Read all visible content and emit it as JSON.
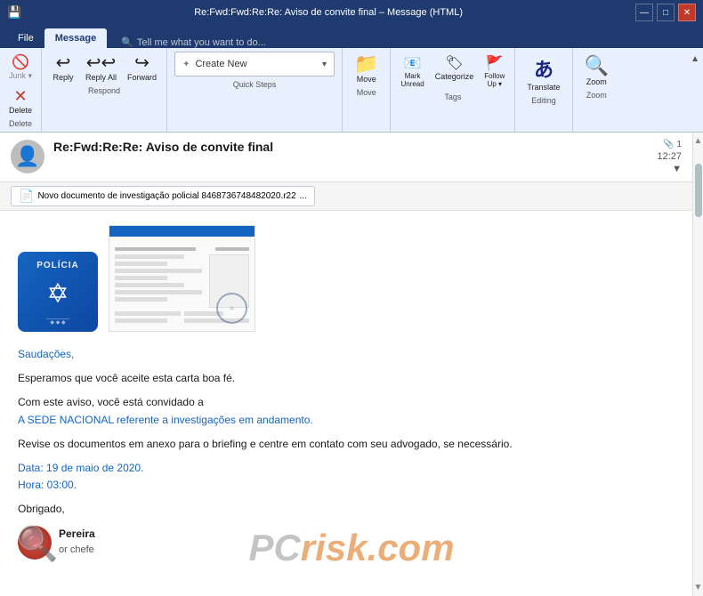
{
  "titlebar": {
    "title": "Re:Fwd:Fwd:Re:Re: Aviso de convite final – Message (HTML)",
    "save_icon": "💾",
    "controls": [
      "🗗",
      "—",
      "□",
      "✕"
    ]
  },
  "ribbon_tabs": {
    "tabs": [
      "File",
      "Message",
      "Tell me what you want to do..."
    ]
  },
  "ribbon": {
    "groups": [
      {
        "label": "Delete",
        "buttons": [
          {
            "id": "junk",
            "icon": "🚫",
            "label": "Junk"
          },
          {
            "id": "delete",
            "icon": "✕",
            "label": "Delete"
          }
        ]
      },
      {
        "label": "Respond",
        "buttons": [
          {
            "id": "reply",
            "icon": "↩",
            "label": "Reply"
          },
          {
            "id": "reply-all",
            "icon": "↩↩",
            "label": "Reply All"
          },
          {
            "id": "forward",
            "icon": "↪",
            "label": "Forward"
          }
        ]
      },
      {
        "label": "Quick Steps",
        "placeholder": "Create New"
      },
      {
        "label": "Move",
        "buttons": [
          {
            "id": "move",
            "icon": "📁",
            "label": "Move"
          }
        ]
      },
      {
        "label": "Tags",
        "buttons": [
          {
            "id": "mark-unread",
            "icon": "📧",
            "label": "Mark Unread"
          },
          {
            "id": "categorize",
            "icon": "🏷",
            "label": "Categorize"
          },
          {
            "id": "follow-up",
            "icon": "🚩",
            "label": "Follow Up"
          }
        ]
      },
      {
        "label": "Editing",
        "buttons": [
          {
            "id": "translate",
            "icon": "あ",
            "label": "Translate"
          }
        ]
      },
      {
        "label": "Zoom",
        "buttons": [
          {
            "id": "zoom",
            "icon": "🔍",
            "label": "Zoom"
          }
        ]
      }
    ]
  },
  "email": {
    "subject": "Re:Fwd:Re:Re: Aviso de convite final",
    "time": "12:27",
    "pin_count": "📎 1",
    "attachment": {
      "icon": "📄",
      "name": "Novo documento de investigação policial 8468736748482020.r22",
      "suffix": "..."
    },
    "body": {
      "greeting": "Saudações,",
      "para1": "Esperamos que você aceite esta carta boa fé.",
      "para2": "Com este aviso, você está convidado a",
      "para3": "A SEDE NACIONAL referente a investigações em andamento.",
      "para4": "Revise os documentos em anexo para o briefing e centre em contato com seu advogado, se necessário.",
      "date_label": "Data: 19 de maio de 2020.",
      "time_label": "Hora: 03:00.",
      "thanks": "Obrigado,",
      "signature_name": "Pereira",
      "signature_role": "or chefe"
    }
  },
  "watermark": {
    "pc_text": "PC",
    "risk_text": "risk.com"
  }
}
